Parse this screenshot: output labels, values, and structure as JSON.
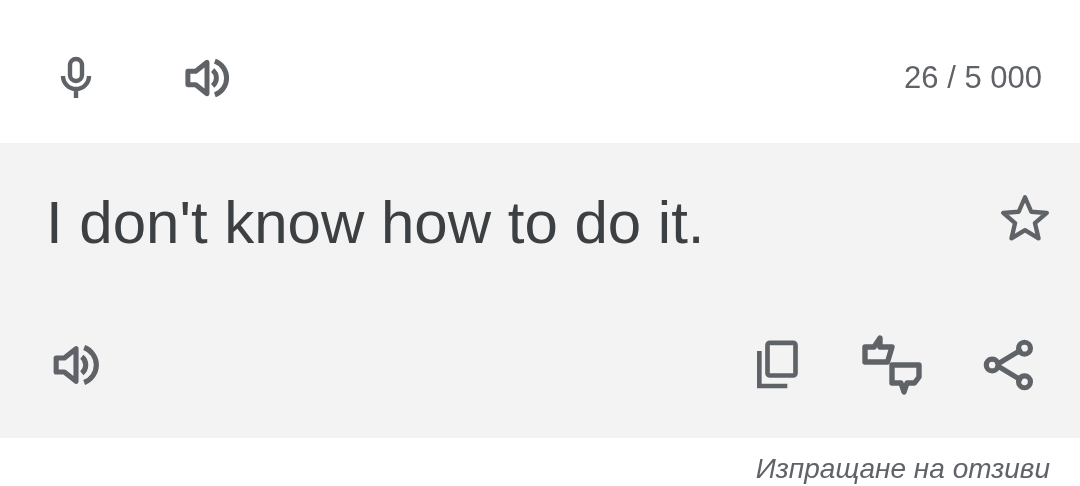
{
  "source_bar": {
    "char_count": "26 / 5 000"
  },
  "translation": {
    "text": "I don't know how to do it.",
    "starred": false
  },
  "feedback_link": "Изпращане на отзиви"
}
